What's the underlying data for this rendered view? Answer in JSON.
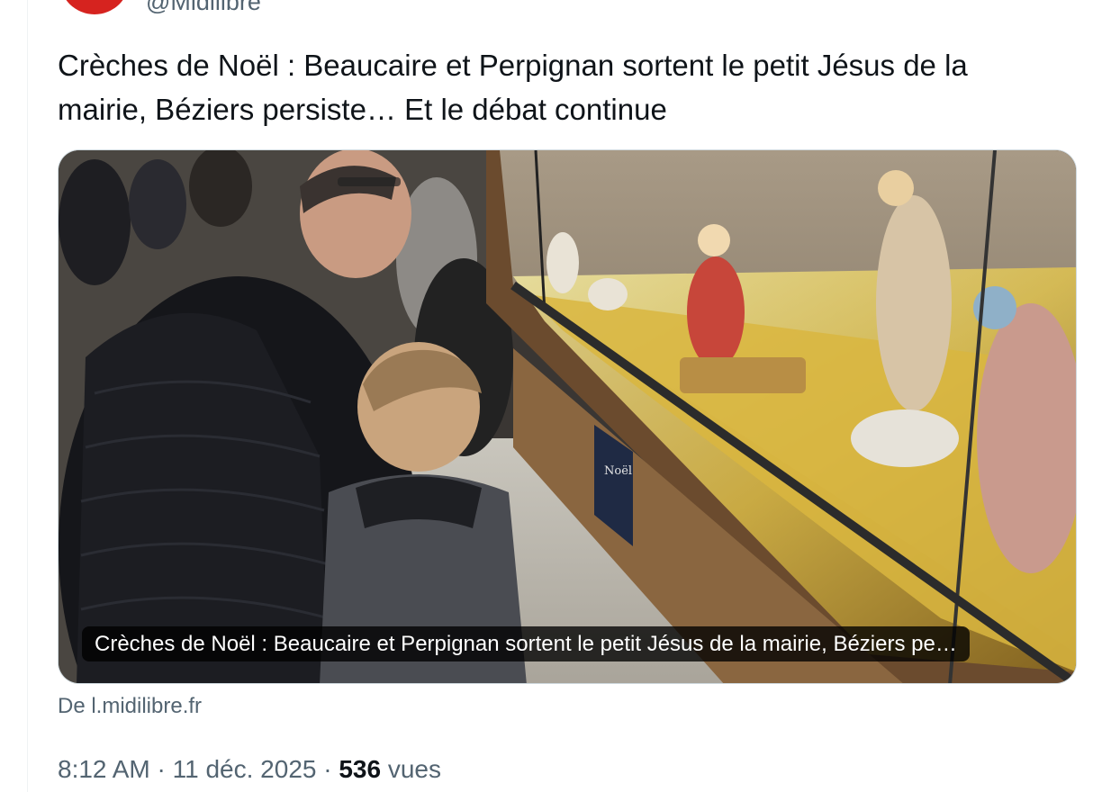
{
  "tweet": {
    "author_handle": "@Midilibre",
    "text": "Crèches de Noël : Beaucaire et Perpignan sortent le petit Jésus de la mairie, Béziers persiste… Et le débat continue",
    "card": {
      "caption": "Crèches de Noël : Beaucaire et Perpignan sortent le petit Jésus de la mairie, Béziers pe…",
      "sign_text": "Noël"
    },
    "source_link": "De l.midilibre.fr",
    "time": "8:12 AM",
    "separator": "·",
    "date": "11 déc. 2025",
    "views_count": "536",
    "views_label": "vues"
  },
  "colors": {
    "text_primary": "#0f1419",
    "text_secondary": "#536471",
    "border": "#cfd9de",
    "avatar_red": "#d6231f"
  }
}
